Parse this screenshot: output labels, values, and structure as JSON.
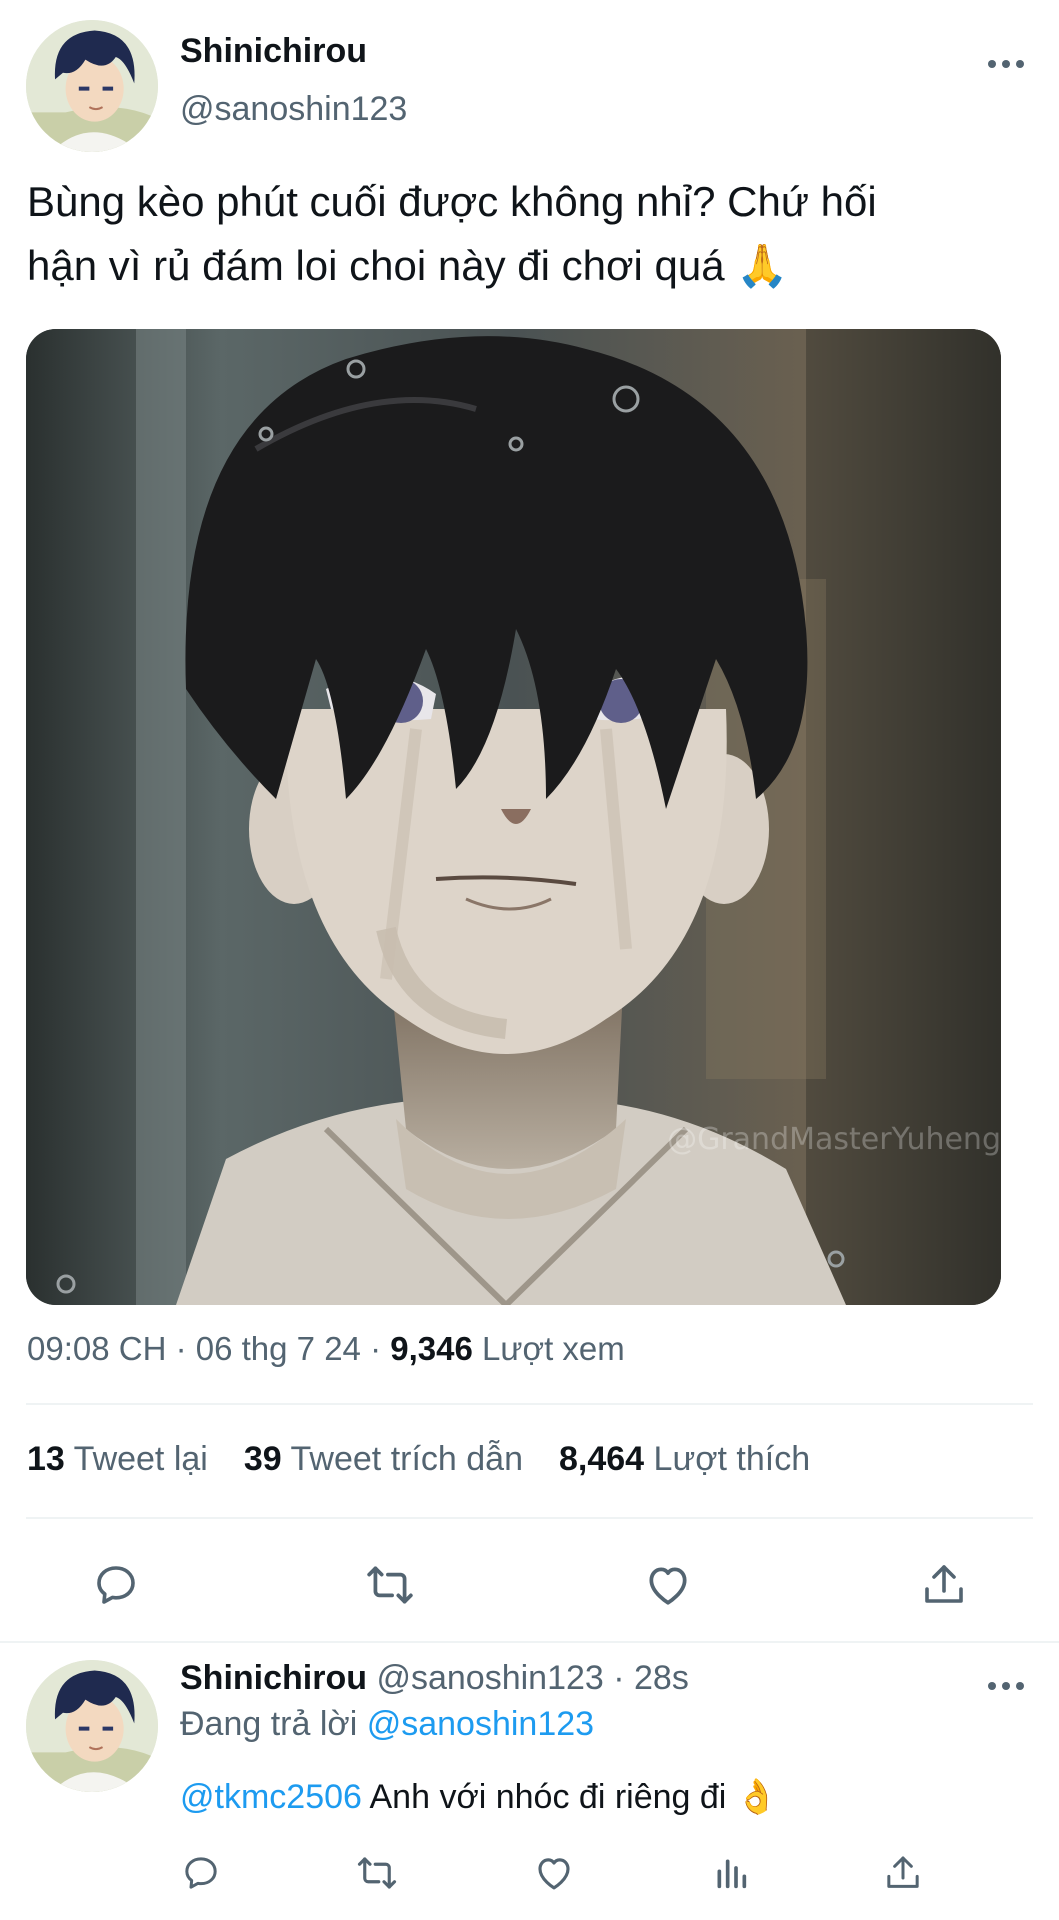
{
  "tweet": {
    "author_name": "Shinichirou",
    "author_handle": "@sanoshin123",
    "text_line1": "Bùng kèo phút cuối được không nhỉ? Chứ hối",
    "text_line2": "hận vì rủ đám loi choi này đi chơi quá",
    "text_emoji": "🙏",
    "image_watermark": "@GrandMasterYuheng",
    "time": "09:08 CH",
    "date": "06 thg 7 24",
    "views_count": "9,346",
    "views_label": "Lượt xem",
    "retweets_count": "13",
    "retweets_label": "Tweet lại",
    "quotes_count": "39",
    "quotes_label": "Tweet trích dẫn",
    "likes_count": "8,464",
    "likes_label": "Lượt thích"
  },
  "reply": {
    "author_name": "Shinichirou",
    "author_handle": "@sanoshin123",
    "time": "28s",
    "replying_label": "Đang trả lời",
    "replying_handle": "@sanoshin123",
    "mention": "@tkmc2506",
    "text": "Anh với nhóc đi riêng đi",
    "emoji": "👌"
  },
  "icons": {
    "main_actions": [
      "reply-icon",
      "retweet-icon",
      "like-icon",
      "share-icon"
    ],
    "reply_actions": [
      "reply-icon",
      "retweet-icon",
      "like-icon",
      "analytics-icon",
      "share-icon"
    ],
    "more": "more-icon"
  },
  "colors": {
    "text_primary": "#0f1419",
    "text_secondary": "#536471",
    "link": "#1d9bf0",
    "divider": "#eff3f4"
  }
}
